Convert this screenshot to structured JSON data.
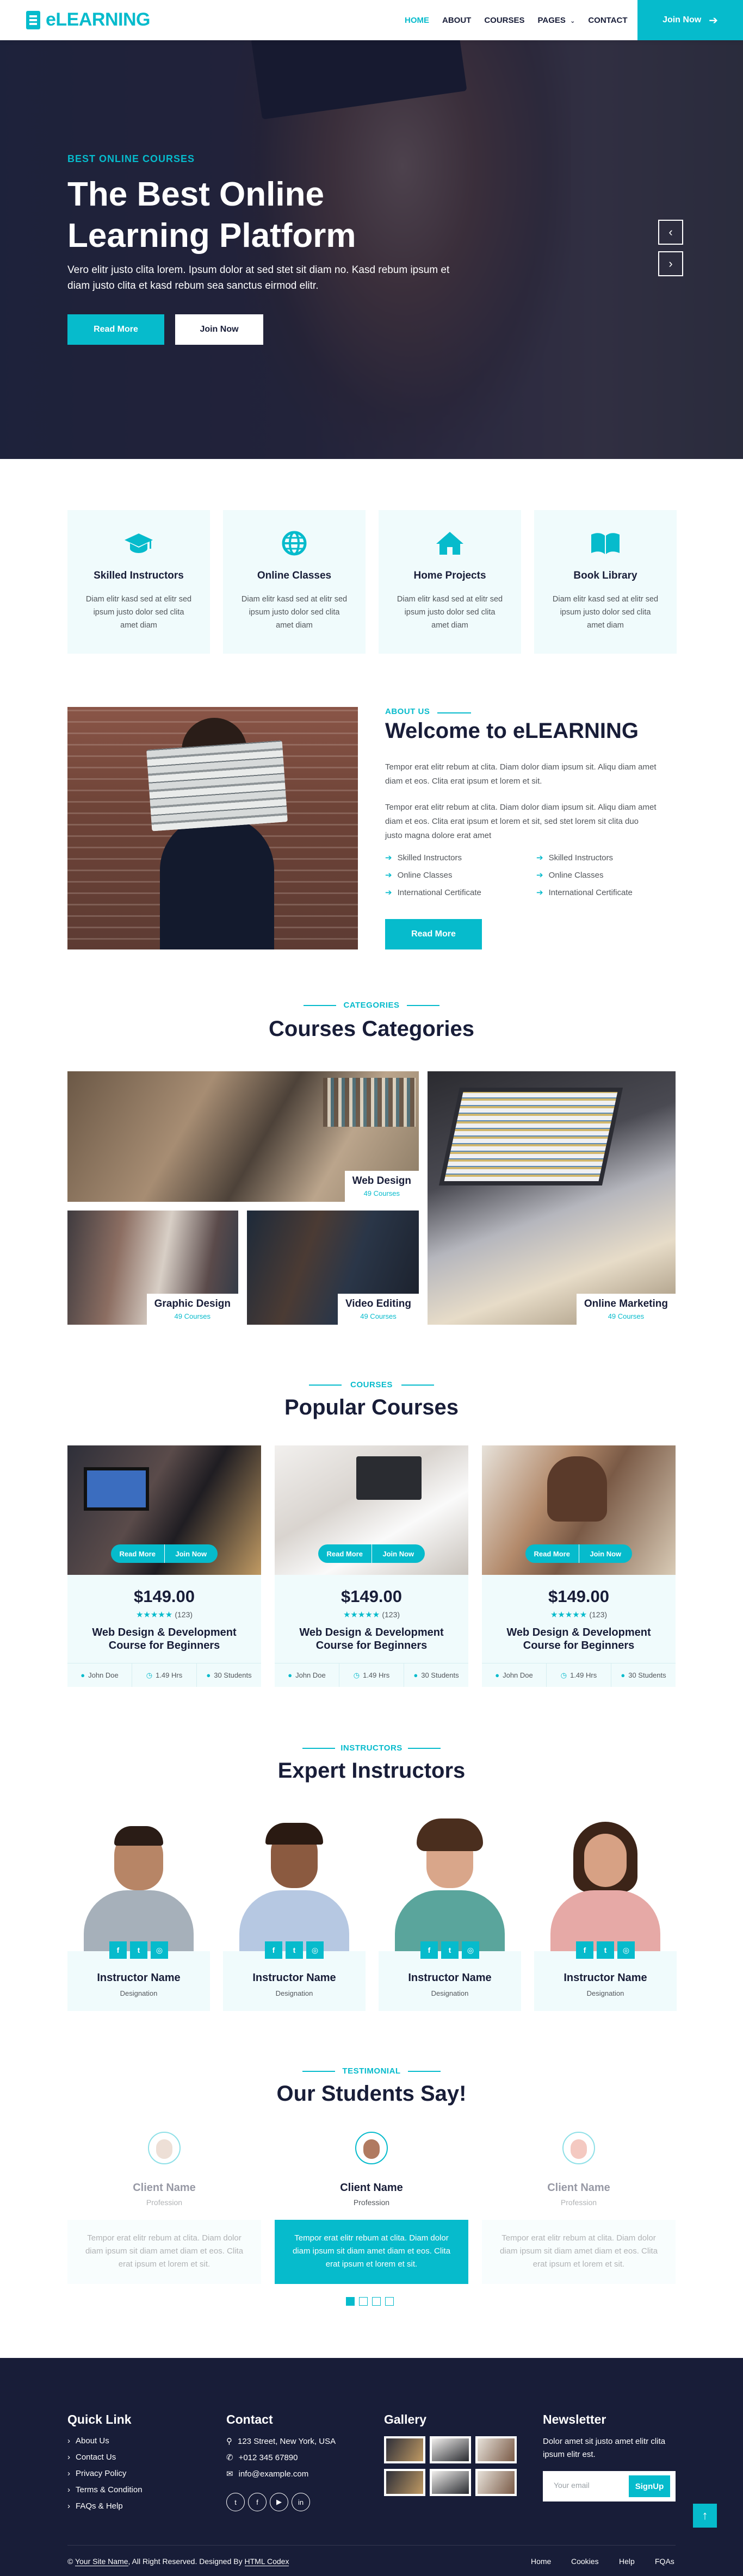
{
  "brand": {
    "name": "eLEARNING",
    "accent": "#06BBCC",
    "dark": "#181d38"
  },
  "nav": {
    "items": [
      "HOME",
      "ABOUT",
      "COURSES",
      "PAGES",
      "CONTACT"
    ],
    "active": "HOME",
    "cta": "Join Now"
  },
  "hero": {
    "eyebrow": "BEST ONLINE COURSES",
    "title": "The Best Online Learning Platform",
    "text": "Vero elitr justo clita lorem. Ipsum dolor at sed stet sit diam no. Kasd rebum ipsum et diam justo clita et kasd rebum sea sanctus eirmod elitr.",
    "btn_read": "Read More",
    "btn_join": "Join Now",
    "prev_icon": "chevron-left-icon",
    "next_icon": "chevron-right-icon"
  },
  "services": [
    {
      "icon": "graduation-cap-icon",
      "title": "Skilled Instructors",
      "text": "Diam elitr kasd sed at elitr sed ipsum justo dolor sed clita amet diam"
    },
    {
      "icon": "globe-icon",
      "title": "Online Classes",
      "text": "Diam elitr kasd sed at elitr sed ipsum justo dolor sed clita amet diam"
    },
    {
      "icon": "home-icon",
      "title": "Home Projects",
      "text": "Diam elitr kasd sed at elitr sed ipsum justo dolor sed clita amet diam"
    },
    {
      "icon": "book-open-icon",
      "title": "Book Library",
      "text": "Diam elitr kasd sed at elitr sed ipsum justo dolor sed clita amet diam"
    }
  ],
  "about": {
    "eyebrow": "ABOUT US",
    "title": "Welcome to eLEARNING",
    "p1": "Tempor erat elitr rebum at clita. Diam dolor diam ipsum sit. Aliqu diam amet diam et eos. Clita erat ipsum et lorem et sit.",
    "p2": "Tempor erat elitr rebum at clita. Diam dolor diam ipsum sit. Aliqu diam amet diam et eos. Clita erat ipsum et lorem et sit, sed stet lorem sit clita duo justo magna dolore erat amet",
    "features": [
      "Skilled Instructors",
      "Online Classes",
      "International Certificate",
      "Skilled Instructors",
      "Online Classes",
      "International Certificate"
    ],
    "btn": "Read More"
  },
  "categories": {
    "eyebrow": "CATEGORIES",
    "title": "Courses Categories",
    "items": [
      {
        "name": "Web Design",
        "count": "49 Courses"
      },
      {
        "name": "Graphic Design",
        "count": "49 Courses"
      },
      {
        "name": "Video Editing",
        "count": "49 Courses"
      },
      {
        "name": "Online Marketing",
        "count": "49 Courses"
      }
    ]
  },
  "courses": {
    "eyebrow": "COURSES",
    "title": "Popular Courses",
    "items": [
      {
        "price": "$149.00",
        "stars": "★★★★★",
        "reviews": "(123)",
        "title": "Web Design & Development Course for Beginners",
        "author": "John Doe",
        "hours": "1.49 Hrs",
        "students": "30 Students",
        "read": "Read More",
        "join": "Join Now"
      },
      {
        "price": "$149.00",
        "stars": "★★★★★",
        "reviews": "(123)",
        "title": "Web Design & Development Course for Beginners",
        "author": "John Doe",
        "hours": "1.49 Hrs",
        "students": "30 Students",
        "read": "Read More",
        "join": "Join Now"
      },
      {
        "price": "$149.00",
        "stars": "★★★★★",
        "reviews": "(123)",
        "title": "Web Design & Development Course for Beginners",
        "author": "John Doe",
        "hours": "1.49 Hrs",
        "students": "30 Students",
        "read": "Read More",
        "join": "Join Now"
      }
    ]
  },
  "instructors": {
    "eyebrow": "INSTRUCTORS",
    "title": "Expert Instructors",
    "items": [
      {
        "name": "Instructor Name",
        "role": "Designation"
      },
      {
        "name": "Instructor Name",
        "role": "Designation"
      },
      {
        "name": "Instructor Name",
        "role": "Designation"
      },
      {
        "name": "Instructor Name",
        "role": "Designation"
      }
    ],
    "social": [
      "f",
      "t",
      "in"
    ]
  },
  "testimonial": {
    "eyebrow": "TESTIMONIAL",
    "title": "Our Students Say!",
    "items": [
      {
        "name": "Client Name",
        "role": "Profession",
        "text": "Tempor erat elitr rebum at clita. Diam dolor diam ipsum sit diam amet diam et eos. Clita erat ipsum et lorem et sit."
      },
      {
        "name": "Client Name",
        "role": "Profession",
        "text": "Tempor erat elitr rebum at clita. Diam dolor diam ipsum sit diam amet diam et eos. Clita erat ipsum et lorem et sit."
      },
      {
        "name": "Client Name",
        "role": "Profession",
        "text": "Tempor erat elitr rebum at clita. Diam dolor diam ipsum sit diam amet diam et eos. Clita erat ipsum et lorem et sit."
      }
    ]
  },
  "footer": {
    "quick_title": "Quick Link",
    "quick_links": [
      "About Us",
      "Contact Us",
      "Privacy Policy",
      "Terms & Condition",
      "FAQs & Help"
    ],
    "contact_title": "Contact",
    "address": "123 Street, New York, USA",
    "phone": "+012 345 67890",
    "email": "info@example.com",
    "gallery_title": "Gallery",
    "news_title": "Newsletter",
    "news_text": "Dolor amet sit justo amet elitr clita ipsum elitr est.",
    "news_placeholder": "Your email",
    "news_btn": "SignUp",
    "copy_site": "Your Site Name",
    "copy_mid": ", All Right Reserved. Designed By ",
    "copy_by": "HTML Codex",
    "bottom_menu": [
      "Home",
      "Cookies",
      "Help",
      "FQAs"
    ]
  }
}
